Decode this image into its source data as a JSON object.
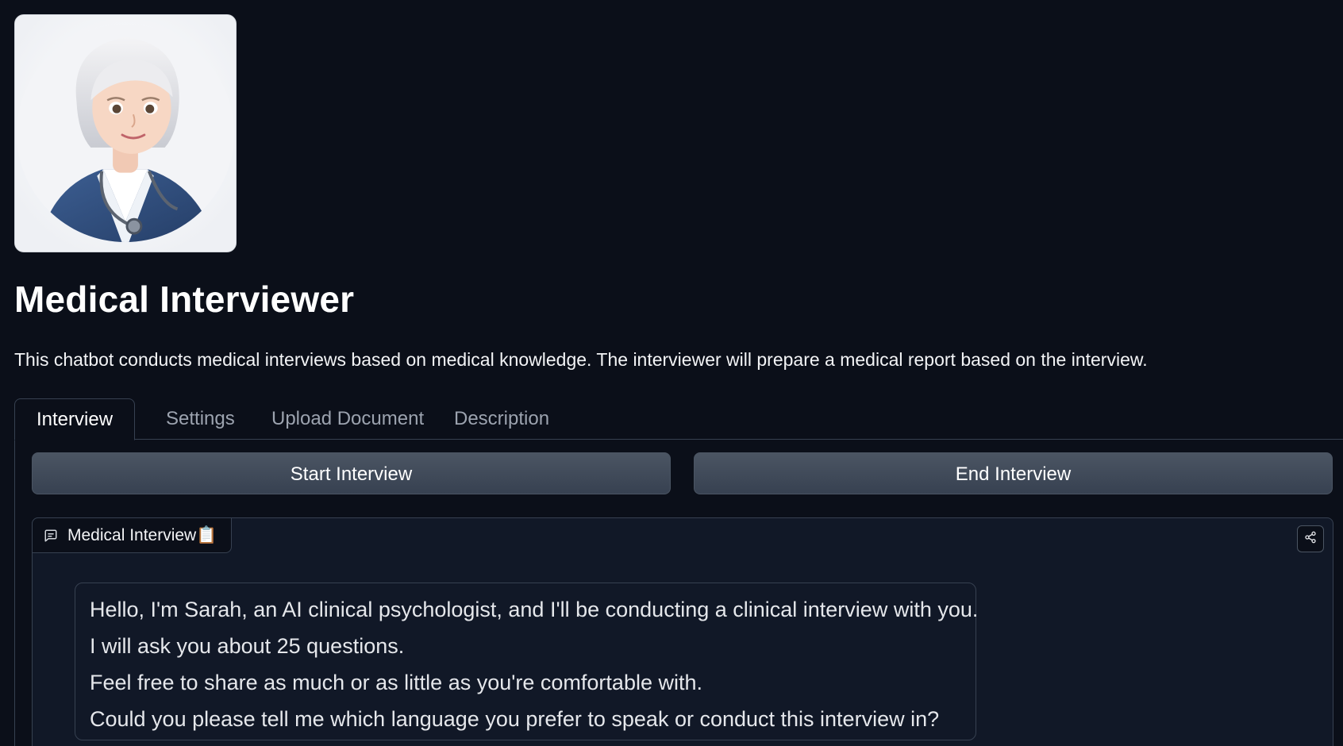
{
  "header": {
    "title": "Medical Interviewer",
    "description": "This chatbot conducts medical interviews based on medical knowledge. The interviewer will prepare a medical report based on the interview."
  },
  "tabs": [
    {
      "label": "Interview",
      "active": true
    },
    {
      "label": "Settings",
      "active": false
    },
    {
      "label": "Upload Document",
      "active": false
    },
    {
      "label": "Description",
      "active": false
    }
  ],
  "controls": {
    "start_label": "Start Interview",
    "end_label": "End Interview"
  },
  "chatbot": {
    "label": "Medical Interview📋",
    "label_icon": "chat-bubble-icon",
    "share_icon": "share-icon",
    "messages": [
      {
        "role": "assistant",
        "lines": [
          "Hello, I'm Sarah, an AI clinical psychologist, and I'll be conducting a clinical interview with you.",
          "I will ask you about 25 questions.",
          "Feel free to share as much or as little as you're comfortable with.",
          "Could you please tell me which language you prefer to speak or conduct this interview in?"
        ]
      }
    ]
  },
  "colors": {
    "background": "#0b0f19",
    "panel": "#111827",
    "border": "#374151",
    "button": "#4b5563",
    "text": "#f3f4f6",
    "muted_text": "#9ca3af"
  }
}
